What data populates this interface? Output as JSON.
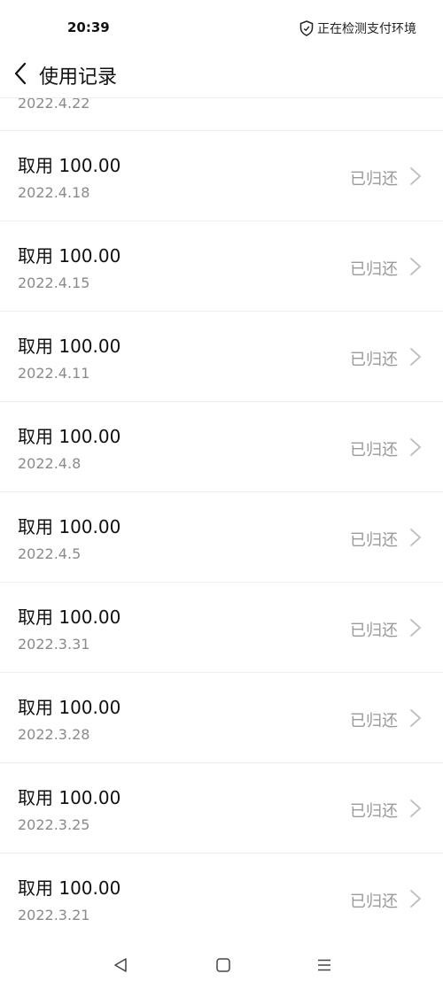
{
  "status_bar": {
    "time": "20:39",
    "security_text": "正在检测支付环境",
    "security_icon": "shield-icon"
  },
  "header": {
    "back_icon": "chevron-left-icon",
    "title": "使用记录"
  },
  "records_partial": {
    "date": "2022.4.22"
  },
  "records": [
    {
      "title": "取用 100.00",
      "date": "2022.4.18",
      "status": "已归还"
    },
    {
      "title": "取用 100.00",
      "date": "2022.4.15",
      "status": "已归还"
    },
    {
      "title": "取用 100.00",
      "date": "2022.4.11",
      "status": "已归还"
    },
    {
      "title": "取用 100.00",
      "date": "2022.4.8",
      "status": "已归还"
    },
    {
      "title": "取用 100.00",
      "date": "2022.4.5",
      "status": "已归还"
    },
    {
      "title": "取用 100.00",
      "date": "2022.3.31",
      "status": "已归还"
    },
    {
      "title": "取用 100.00",
      "date": "2022.3.28",
      "status": "已归还"
    },
    {
      "title": "取用 100.00",
      "date": "2022.3.25",
      "status": "已归还"
    },
    {
      "title": "取用 100.00",
      "date": "2022.3.21",
      "status": "已归还"
    }
  ],
  "nav_bar": {
    "back_icon": "triangle-back-icon",
    "home_icon": "square-home-icon",
    "menu_icon": "menu-icon"
  }
}
